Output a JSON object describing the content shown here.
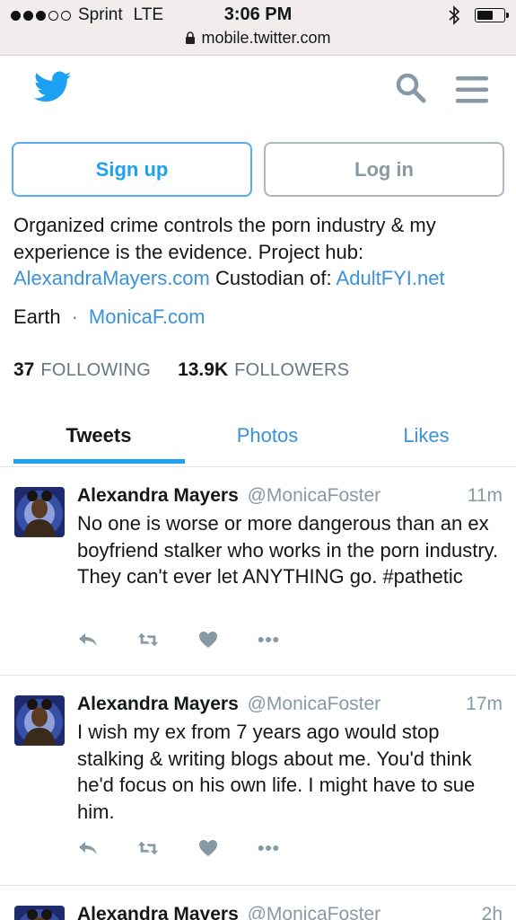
{
  "status_bar": {
    "carrier": "Sprint",
    "network": "LTE",
    "time": "3:06 PM",
    "url": "mobile.twitter.com",
    "signal_bars": 3,
    "signal_total": 5,
    "battery_level": 0.6
  },
  "header": {
    "logo_icon": "twitter-bird-icon",
    "search_icon": "search-icon",
    "menu_icon": "hamburger-menu-icon"
  },
  "auth": {
    "signup_label": "Sign up",
    "login_label": "Log in"
  },
  "profile": {
    "bio_line1": "Organized crime controls the porn industry & my",
    "bio_line2": "experience is the evidence. Project hub:",
    "bio_link1": "AlexandraMayers.com",
    "bio_custodian": "Custodian of:",
    "bio_link2": "AdultFYI.net",
    "location": "Earth",
    "separator": "·",
    "website": "MonicaF.com",
    "following_count": "37",
    "following_label": "FOLLOWING",
    "followers_count": "13.9K",
    "followers_label": "FOLLOWERS"
  },
  "tabs": [
    {
      "label": "Tweets",
      "active": true
    },
    {
      "label": "Photos",
      "active": false
    },
    {
      "label": "Likes",
      "active": false
    }
  ],
  "tweets": [
    {
      "name": "Alexandra Mayers",
      "handle": "@MonicaFoster",
      "time": "11m",
      "text": "No one is worse or more dangerous than an ex boyfriend stalker who works in the porn industry. They can't ever let ANYTHING go. #pathetic"
    },
    {
      "name": "Alexandra Mayers",
      "handle": "@MonicaFoster",
      "time": "17m",
      "text": "I wish my ex from 7 years ago would stop stalking & writing blogs about me. You'd think he'd focus on his own life. I might have to sue him."
    },
    {
      "name": "Alexandra Mayers",
      "handle": "@MonicaFoster",
      "time": "2h",
      "text": ""
    }
  ],
  "colors": {
    "brand_blue": "#1da1f2",
    "link_blue": "#3a93d8",
    "muted_gray": "#8899a6",
    "status_bar_bg": "#f1eded"
  }
}
